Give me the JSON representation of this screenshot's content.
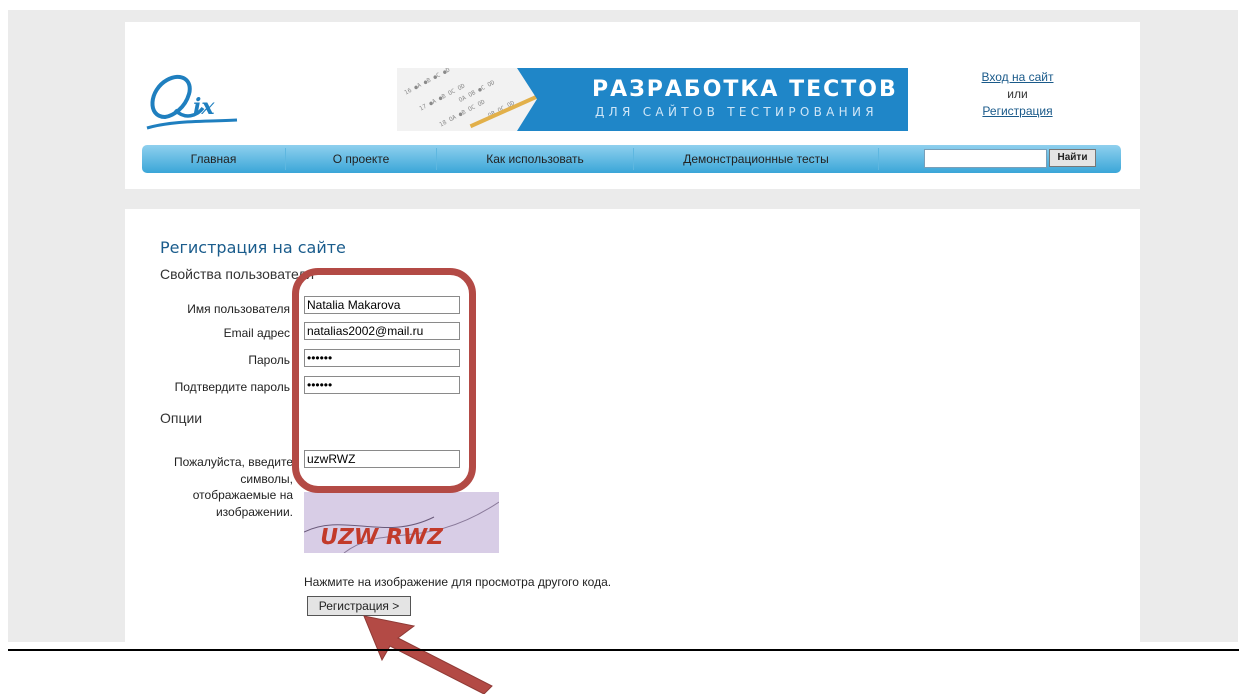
{
  "header": {
    "banner_title": "РАЗРАБОТКА ТЕСТОВ",
    "banner_subtitle": "ДЛЯ САЙТОВ ТЕСТИРОВАНИЯ",
    "login_link": "Вход на сайт",
    "or_text": "или",
    "register_link": "Регистрация"
  },
  "nav": {
    "items": [
      "Главная",
      "О проекте",
      "Как использовать",
      "Демонстрационные тесты"
    ],
    "search_value": "",
    "search_button": "Найти"
  },
  "form": {
    "title": "Регистрация на сайте",
    "section_user": "Свойства пользователя",
    "username_label": "Имя пользователя",
    "username_value": "Natalia Makarova",
    "email_label": "Email адрес",
    "email_value": "natalias2002@mail.ru",
    "password_label": "Пароль",
    "password_value": "••••••",
    "confirm_label": "Подтвердите пароль",
    "confirm_value": "••••••",
    "section_options": "Опции",
    "captcha_label": "Пожалуйста, введите символы, отображаемые на изображении.",
    "captcha_value": "uzwRWZ",
    "captcha_image_text": "UZW RWZ",
    "hint": "Нажмите на изображение для просмотра другого кода.",
    "submit": "Регистрация >"
  },
  "colors": {
    "highlight": "#b34a45",
    "nav_top": "#8fd0ee",
    "nav_bottom": "#3aa6d8",
    "title": "#1a5c8c",
    "banner": "#1f86c8"
  }
}
